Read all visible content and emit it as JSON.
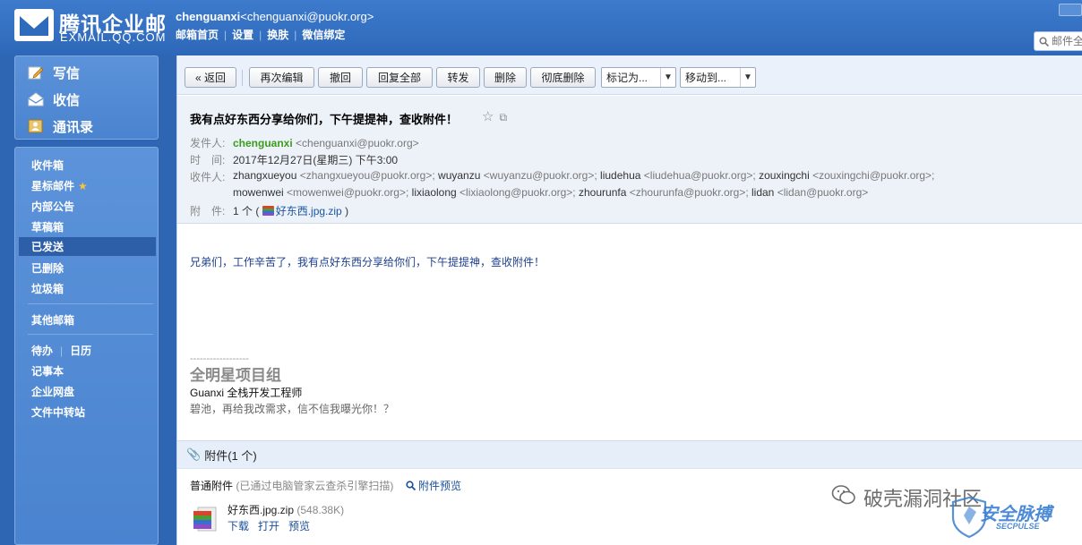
{
  "brand": {
    "title": "腾讯企业邮",
    "subtitle": "EXMAIL.QQ.COM"
  },
  "account": {
    "name": "chenguanxi",
    "email": "<chenguanxi@puokr.org>",
    "links": [
      "邮箱首页",
      "设置",
      "换肤",
      "微信绑定"
    ]
  },
  "search": {
    "placeholder": "邮件全"
  },
  "sidebar": {
    "primary": [
      {
        "label": "写信",
        "icon": "pencil-icon"
      },
      {
        "label": "收信",
        "icon": "inbox-icon"
      },
      {
        "label": "通讯录",
        "icon": "contacts-icon"
      }
    ],
    "folders": [
      {
        "label": "收件箱"
      },
      {
        "label": "星标邮件"
      },
      {
        "label": "内部公告"
      },
      {
        "label": "草稿箱"
      },
      {
        "label": "已发送",
        "active": true
      },
      {
        "label": "已删除"
      },
      {
        "label": "垃圾箱"
      }
    ],
    "other_mailboxes": "其他邮箱",
    "todo": "待办",
    "calendar": "日历",
    "notes": "记事本",
    "netdisk": "企业网盘",
    "transfer": "文件中转站"
  },
  "toolbar": {
    "back": "« 返回",
    "edit_again": "再次编辑",
    "recall": "撤回",
    "reply_all": "回复全部",
    "forward": "转发",
    "delete": "删除",
    "delete_permanent": "彻底删除",
    "mark_as": "标记为...",
    "move_to": "移动到..."
  },
  "email": {
    "subject": "我有点好东西分享给你们，下午提提神，查收附件！",
    "from_label": "发件人:",
    "from_name": "chenguanxi",
    "from_addr": "<chenguanxi@puokr.org>",
    "time_label": "时　间:",
    "time": "2017年12月27日(星期三) 下午3:00",
    "to_label": "收件人:",
    "recipients": [
      {
        "name": "zhangxueyou",
        "addr": "<zhangxueyou@puokr.org>;"
      },
      {
        "name": "wuyanzu",
        "addr": "<wuyanzu@puokr.org>;"
      },
      {
        "name": "liudehua",
        "addr": "<liudehua@puokr.org>;"
      },
      {
        "name": "zouxingchi",
        "addr": "<zouxingchi@puokr.org>;"
      },
      {
        "name": "mowenwei",
        "addr": "<mowenwei@puokr.org>;"
      },
      {
        "name": "lixiaolong",
        "addr": "<lixiaolong@puokr.org>;"
      },
      {
        "name": "zhourunfa",
        "addr": "<zhourunfa@puokr.org>;"
      },
      {
        "name": "lidan",
        "addr": "<lidan@puokr.org>"
      }
    ],
    "attach_label": "附　件:",
    "attach_count": "1 个 (",
    "attach_name": "好东西.jpg.zip",
    "attach_close": ")",
    "body": "兄弟们，工作辛苦了，我有点好东西分享给你们，下午提提神，查收附件！",
    "sig_line": "------------------",
    "sig_title": "全明星项目组",
    "sig_name": "Guanxi 全栈开发工程师",
    "sig_motto": "碧池，再给我改需求，信不信我曝光你！？"
  },
  "attachments": {
    "heading": "附件",
    "count": "(1 个)",
    "section": "普通附件",
    "scan_note": "(已通过电脑管家云查杀引擎扫描)",
    "preview_label": "附件预览",
    "file_name": "好东西.jpg.zip",
    "file_size": "(548.38K)",
    "actions": [
      "下载",
      "打开",
      "预览"
    ]
  },
  "watermark": {
    "text": "破壳漏洞社区",
    "logo_text": "安全脉搏",
    "logo_sub": "SECPULSE"
  }
}
